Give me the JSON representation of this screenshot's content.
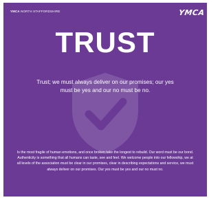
{
  "header": {
    "org_prefix": "YMCA",
    "org_rest": " NORTH STAFFORDSHIRE",
    "logo_text": "YMCA"
  },
  "headline": "TRUST",
  "subtitle": "Trust; we must always deliver on our promises; our yes must be yes and our no must be no.",
  "body_text": "Is the most fragile of human emotions, and once broken take the longest to rebuild. Our word must be our bond. Authenticity is something that all humans can taste, see and feel. We welcome people into our fellowship, we at all levels of the association must be clear in our promises, clear in describing expectations and service, we must always deliver on our promises. Our yes must be yes and our no must no.",
  "watermark_icon": "shield-check-icon",
  "colors": {
    "background": "#6a3a95",
    "text": "#ffffff"
  }
}
